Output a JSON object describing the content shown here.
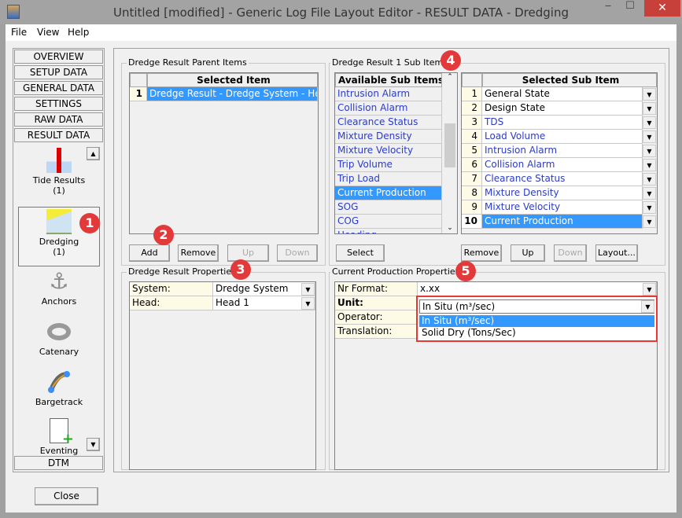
{
  "window": {
    "title": "Untitled [modified] - Generic Log File Layout Editor -  RESULT DATA -  Dredging",
    "minimize": "‒",
    "maximize": "☐",
    "close": "✕"
  },
  "menu": [
    "File",
    "View",
    "Help"
  ],
  "nav": {
    "buttons": [
      "OVERVIEW",
      "SETUP DATA",
      "GENERAL DATA",
      "SETTINGS",
      "RAW DATA",
      "RESULT DATA"
    ],
    "items": [
      {
        "label": "Tide Results",
        "count": "(1)"
      },
      {
        "label": "Dredging",
        "count": "(1)"
      },
      {
        "label": "Anchors"
      },
      {
        "label": "Catenary"
      },
      {
        "label": "Bargetrack"
      },
      {
        "label": "Eventing"
      }
    ],
    "bottom": "DTM",
    "scroll_up": "▲",
    "scroll_down": "▼"
  },
  "parent": {
    "group_label": "Dredge Result Parent Items",
    "header": "Selected Item",
    "rows": [
      {
        "num": "1",
        "value": "Dredge Result  -  Dredge System - Hea..."
      }
    ],
    "buttons": {
      "add": "Add",
      "remove": "Remove",
      "up": "Up",
      "down": "Down"
    }
  },
  "parent_props": {
    "group_label": "Dredge Result Properties",
    "rows": [
      {
        "label": "System:",
        "value": "Dredge System"
      },
      {
        "label": "Head:",
        "value": "Head 1"
      }
    ]
  },
  "sub": {
    "group_label": "Dredge Result 1 Sub Items",
    "available_header": "Available Sub Items",
    "available": [
      "Intrusion Alarm",
      "Collision Alarm",
      "Clearance Status",
      "Mixture Density",
      "Mixture Velocity",
      "Trip Volume",
      "Trip Load",
      "Current Production",
      "SOG",
      "COG",
      "Heading"
    ],
    "available_selected": "Current Production",
    "selected_header": "Selected Sub Item",
    "selected": [
      {
        "num": "1",
        "value": "General State"
      },
      {
        "num": "2",
        "value": "Design State"
      },
      {
        "num": "3",
        "value": "TDS"
      },
      {
        "num": "4",
        "value": "Load Volume"
      },
      {
        "num": "5",
        "value": "Intrusion Alarm"
      },
      {
        "num": "6",
        "value": "Collision Alarm"
      },
      {
        "num": "7",
        "value": "Clearance Status"
      },
      {
        "num": "8",
        "value": "Mixture Density"
      },
      {
        "num": "9",
        "value": "Mixture Velocity"
      },
      {
        "num": "10",
        "value": "Current Production"
      }
    ],
    "buttons": {
      "select": "Select",
      "remove": "Remove",
      "up": "Up",
      "down": "Down",
      "layout": "Layout..."
    }
  },
  "cp_props": {
    "group_label": "Current Production Properties",
    "rows": [
      {
        "label": "Nr Format:",
        "value": "x.xx"
      },
      {
        "label": "Unit:",
        "value": "In Situ (m³/sec)"
      },
      {
        "label": "Operator:",
        "value": ""
      },
      {
        "label": "Translation:",
        "value": ""
      }
    ],
    "dropdown_options": [
      "In Situ (m³/sec)",
      "Solid Dry (Tons/Sec)"
    ],
    "dropdown_selected": "In Situ (m³/sec)"
  },
  "badges": [
    "1",
    "2",
    "3",
    "4",
    "5"
  ],
  "footer": {
    "close": "Close"
  },
  "colors": {
    "selection": "#3399ff",
    "badge": "#e23a3a",
    "highlight_border": "#e53935"
  }
}
